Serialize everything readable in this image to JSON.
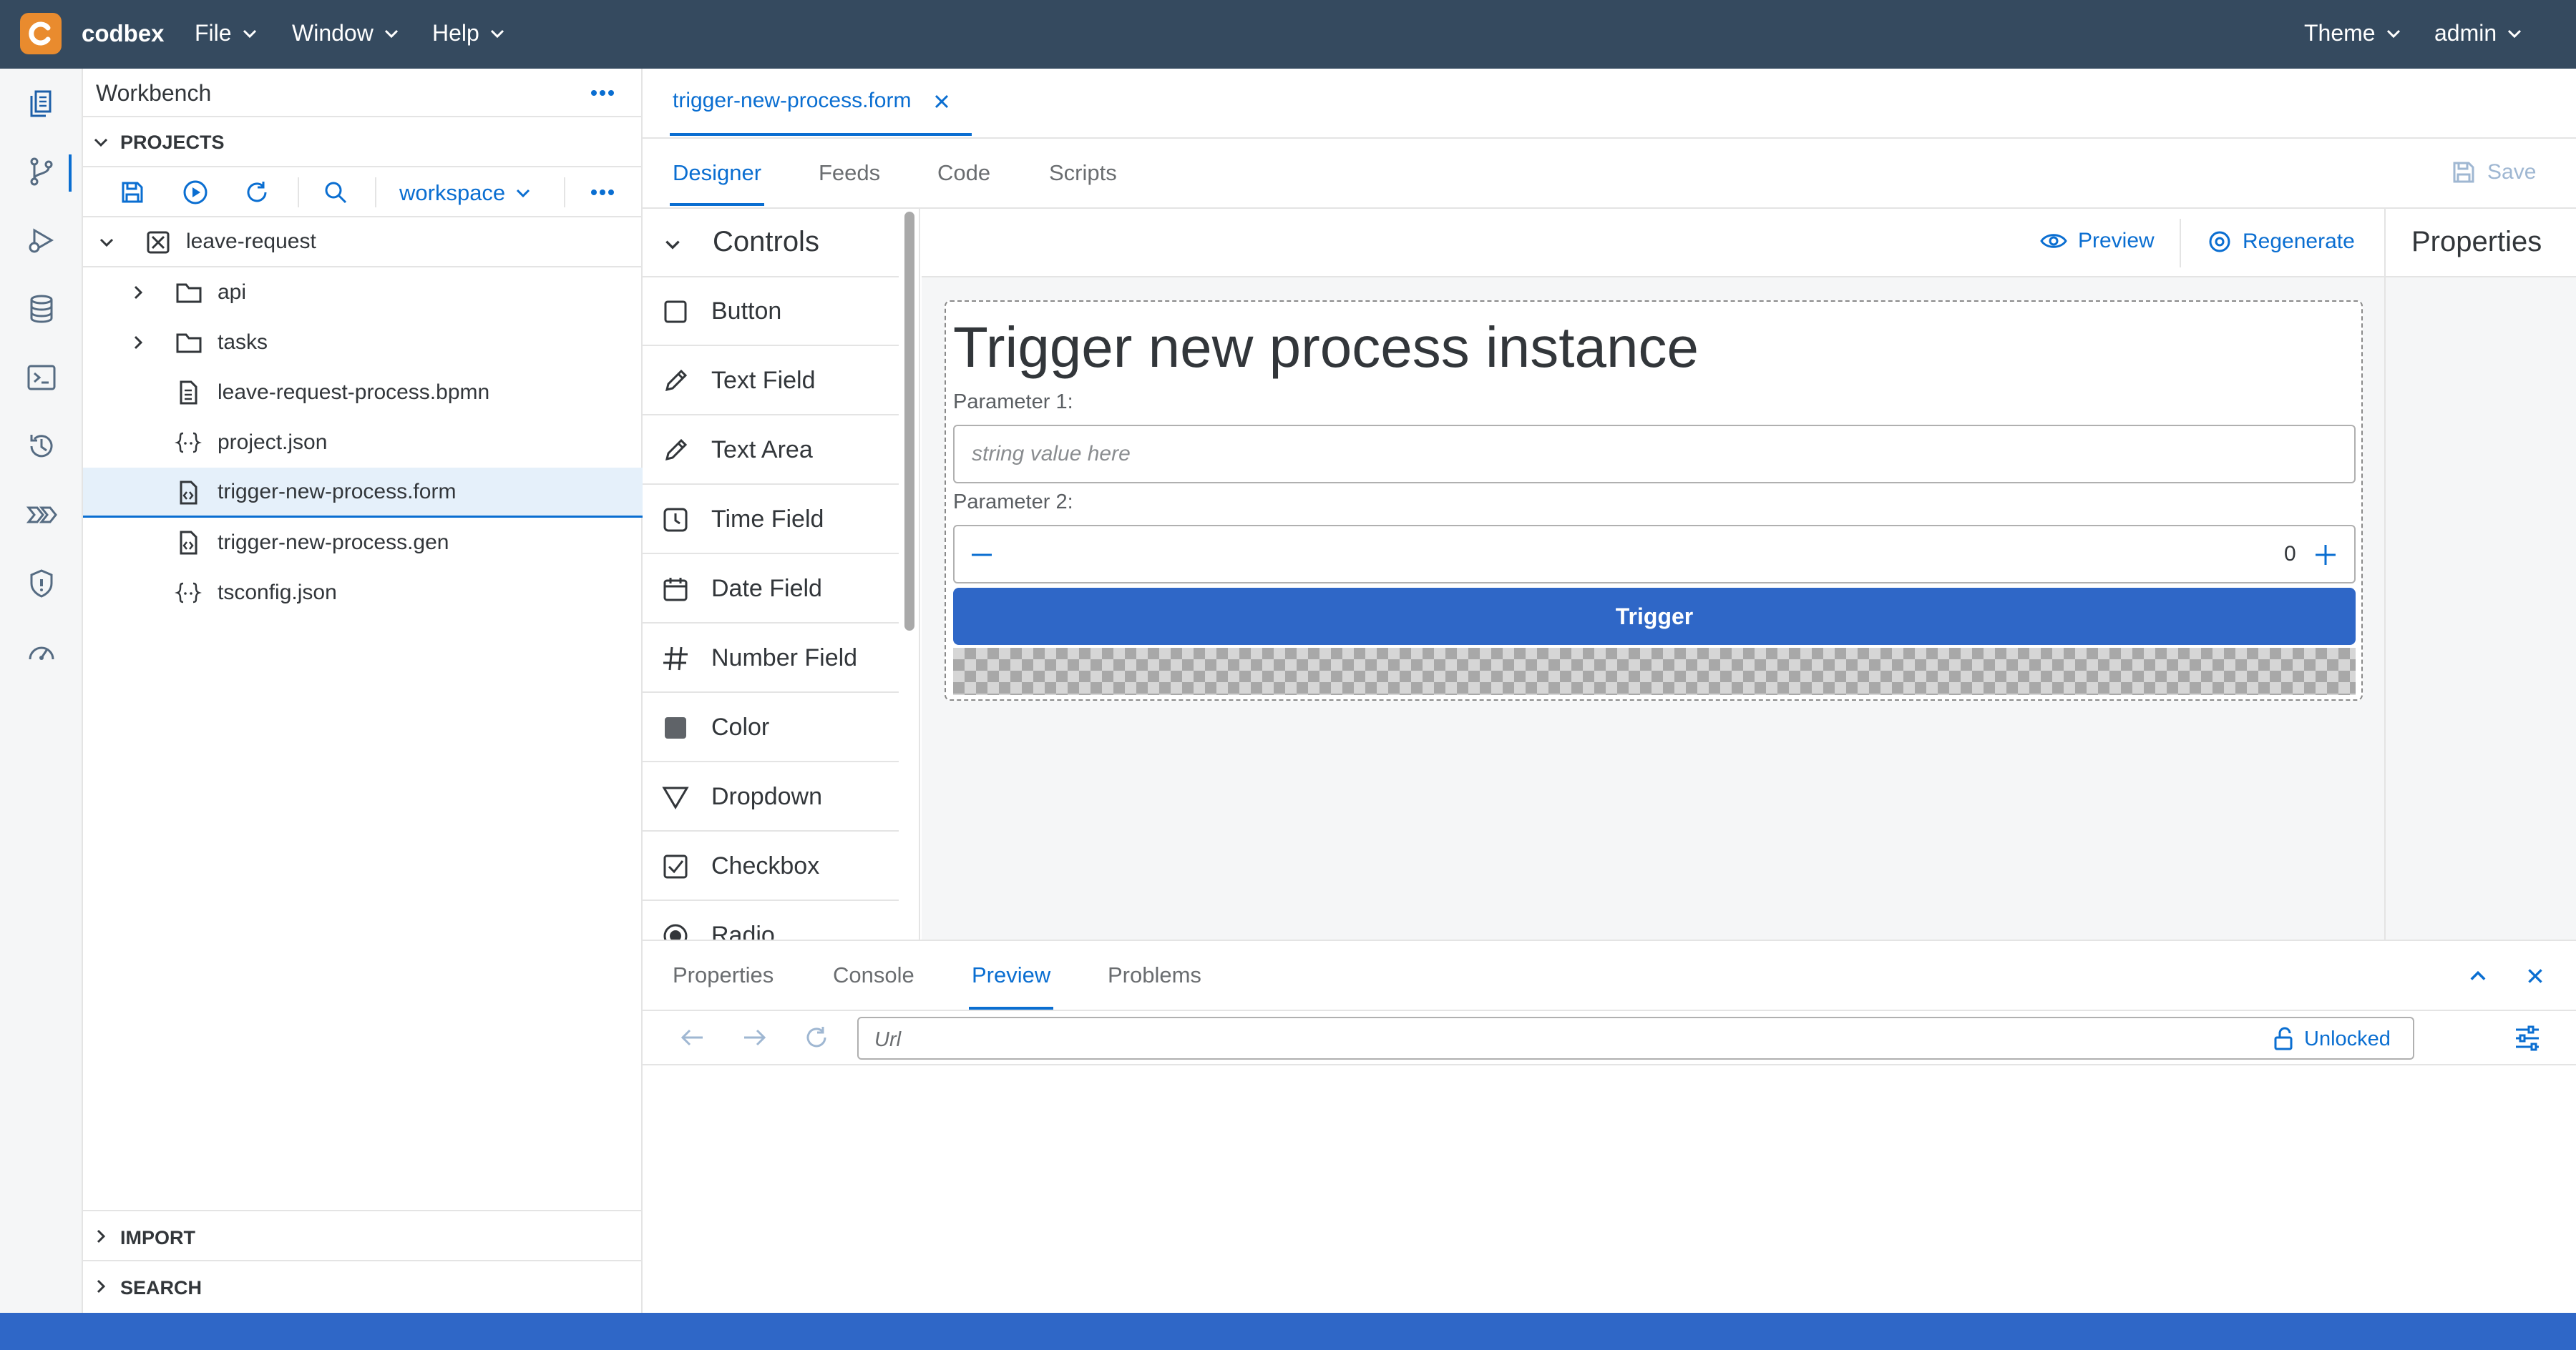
{
  "shell": {
    "brand": "codbex",
    "menus": [
      {
        "label": "File"
      },
      {
        "label": "Window"
      },
      {
        "label": "Help"
      }
    ],
    "theme_label": "Theme",
    "user_label": "admin"
  },
  "sidebar": {
    "title": "Workbench",
    "sections": {
      "projects": "PROJECTS",
      "import": "IMPORT",
      "search": "SEARCH"
    },
    "workspace_label": "workspace",
    "tree": [
      {
        "label": "leave-request"
      },
      {
        "label": "api"
      },
      {
        "label": "tasks"
      },
      {
        "label": "leave-request-process.bpmn"
      },
      {
        "label": "project.json"
      },
      {
        "label": "trigger-new-process.form"
      },
      {
        "label": "trigger-new-process.gen"
      },
      {
        "label": "tsconfig.json"
      }
    ]
  },
  "editor": {
    "file_tab": "trigger-new-process.form",
    "tabs": [
      {
        "label": "Designer"
      },
      {
        "label": "Feeds"
      },
      {
        "label": "Code"
      },
      {
        "label": "Scripts"
      }
    ],
    "save_label": "Save",
    "controls_title": "Controls",
    "controls": [
      {
        "label": "Button",
        "icon": "square-icon"
      },
      {
        "label": "Text Field",
        "icon": "pencil-icon"
      },
      {
        "label": "Text Area",
        "icon": "pencil-icon"
      },
      {
        "label": "Time Field",
        "icon": "clock-icon"
      },
      {
        "label": "Date Field",
        "icon": "calendar-icon"
      },
      {
        "label": "Number Field",
        "icon": "hash-icon"
      },
      {
        "label": "Color",
        "icon": "color-square-icon"
      },
      {
        "label": "Dropdown",
        "icon": "triangle-down-icon"
      },
      {
        "label": "Checkbox",
        "icon": "checkbox-icon"
      },
      {
        "label": "Radio",
        "icon": "radio-icon"
      }
    ],
    "preview_label": "Preview",
    "regenerate_label": "Regenerate",
    "properties_title": "Properties"
  },
  "form": {
    "title": "Trigger new process instance",
    "param1_label": "Parameter 1:",
    "param1_placeholder": "string value here",
    "param2_label": "Parameter 2:",
    "param2_value": "0",
    "trigger_label": "Trigger"
  },
  "bottom": {
    "tabs": [
      {
        "label": "Properties"
      },
      {
        "label": "Console"
      },
      {
        "label": "Preview"
      },
      {
        "label": "Problems"
      }
    ],
    "url_placeholder": "Url",
    "unlocked_label": "Unlocked"
  },
  "colors": {
    "shell_bg": "#354a5f",
    "accent": "#0a6ed1",
    "button_blue": "#2f67c7",
    "brand_orange": "#e98b2e"
  }
}
